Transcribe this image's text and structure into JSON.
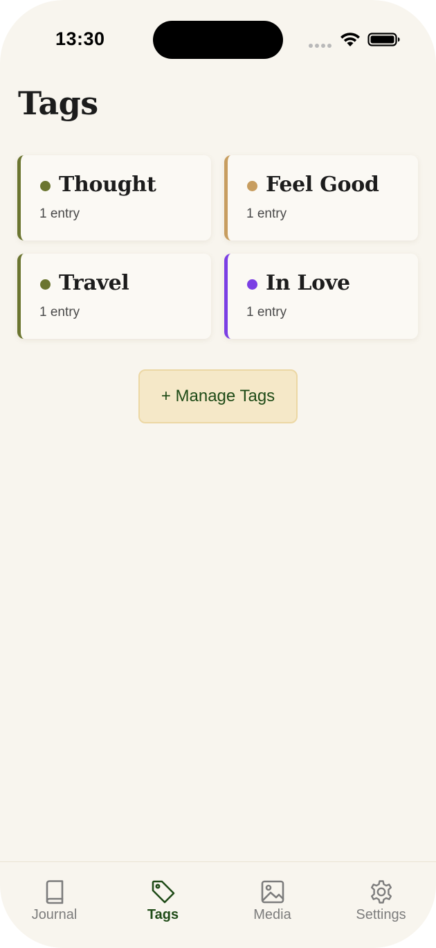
{
  "status_bar": {
    "time": "13:30"
  },
  "page": {
    "title": "Tags"
  },
  "tags": [
    {
      "name": "Thought",
      "count_label": "1 entry",
      "color": "#6b7530"
    },
    {
      "name": "Feel Good",
      "count_label": "1 entry",
      "color": "#c79d5f"
    },
    {
      "name": "Travel",
      "count_label": "1 entry",
      "color": "#6b7530"
    },
    {
      "name": "In Love",
      "count_label": "1 entry",
      "color": "#7b3fe4"
    }
  ],
  "manage_button": {
    "label": "+ Manage Tags"
  },
  "tab_bar": {
    "active_color": "#1f4b17",
    "inactive_color": "#7c7c7c",
    "items": [
      {
        "label": "Journal",
        "icon": "book-icon",
        "active": false
      },
      {
        "label": "Tags",
        "icon": "tag-icon",
        "active": true
      },
      {
        "label": "Media",
        "icon": "image-icon",
        "active": false
      },
      {
        "label": "Settings",
        "icon": "gear-icon",
        "active": false
      }
    ]
  }
}
